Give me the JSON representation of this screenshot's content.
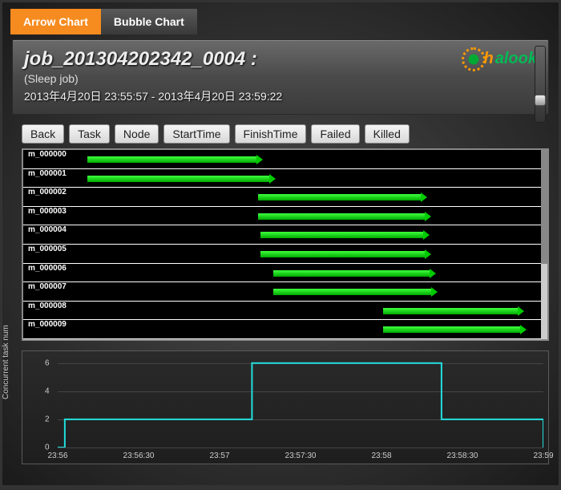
{
  "tabs": {
    "active": "Arrow Chart",
    "inactive": "Bubble Chart"
  },
  "header": {
    "title": "job_201304202342_0004  :",
    "subtitle": "(Sleep job)",
    "range": "2013年4月20日 23:55:57 - 2013年4月20日 23:59:22"
  },
  "logo": {
    "h": "h",
    "rest": "alook"
  },
  "buttons": {
    "back": "Back",
    "task": "Task",
    "node": "Node",
    "start": "StartTime",
    "finish": "FinishTime",
    "failed": "Failed",
    "killed": "Killed"
  },
  "chart_data": {
    "type": "gantt_and_line",
    "time_window": {
      "start": "23:55:57",
      "end": "23:59:22",
      "span_sec": 205
    },
    "tasks": [
      {
        "id": "m_000000",
        "start_sec": 0,
        "end_sec": 80
      },
      {
        "id": "m_000001",
        "start_sec": 0,
        "end_sec": 86
      },
      {
        "id": "m_000002",
        "start_sec": 81,
        "end_sec": 158
      },
      {
        "id": "m_000003",
        "start_sec": 81,
        "end_sec": 160
      },
      {
        "id": "m_000004",
        "start_sec": 82,
        "end_sec": 159
      },
      {
        "id": "m_000005",
        "start_sec": 82,
        "end_sec": 160
      },
      {
        "id": "m_000006",
        "start_sec": 88,
        "end_sec": 162
      },
      {
        "id": "m_000007",
        "start_sec": 88,
        "end_sec": 163
      },
      {
        "id": "m_000008",
        "start_sec": 140,
        "end_sec": 204
      },
      {
        "id": "m_000009",
        "start_sec": 140,
        "end_sec": 205
      }
    ],
    "concurrent": {
      "ylabel": "Concurrent task num",
      "yticks": [
        0,
        2,
        4,
        6
      ],
      "ylim": [
        0,
        6.5
      ],
      "xticks": [
        "23:56",
        "23:56:30",
        "23:57",
        "23:57:30",
        "23:58",
        "23:58:30",
        "23:59"
      ],
      "points": [
        [
          0,
          0
        ],
        [
          3,
          2
        ],
        [
          80,
          2
        ],
        [
          82,
          6
        ],
        [
          88,
          6
        ],
        [
          158,
          6
        ],
        [
          162,
          2
        ],
        [
          200,
          2
        ],
        [
          205,
          0
        ]
      ]
    }
  }
}
